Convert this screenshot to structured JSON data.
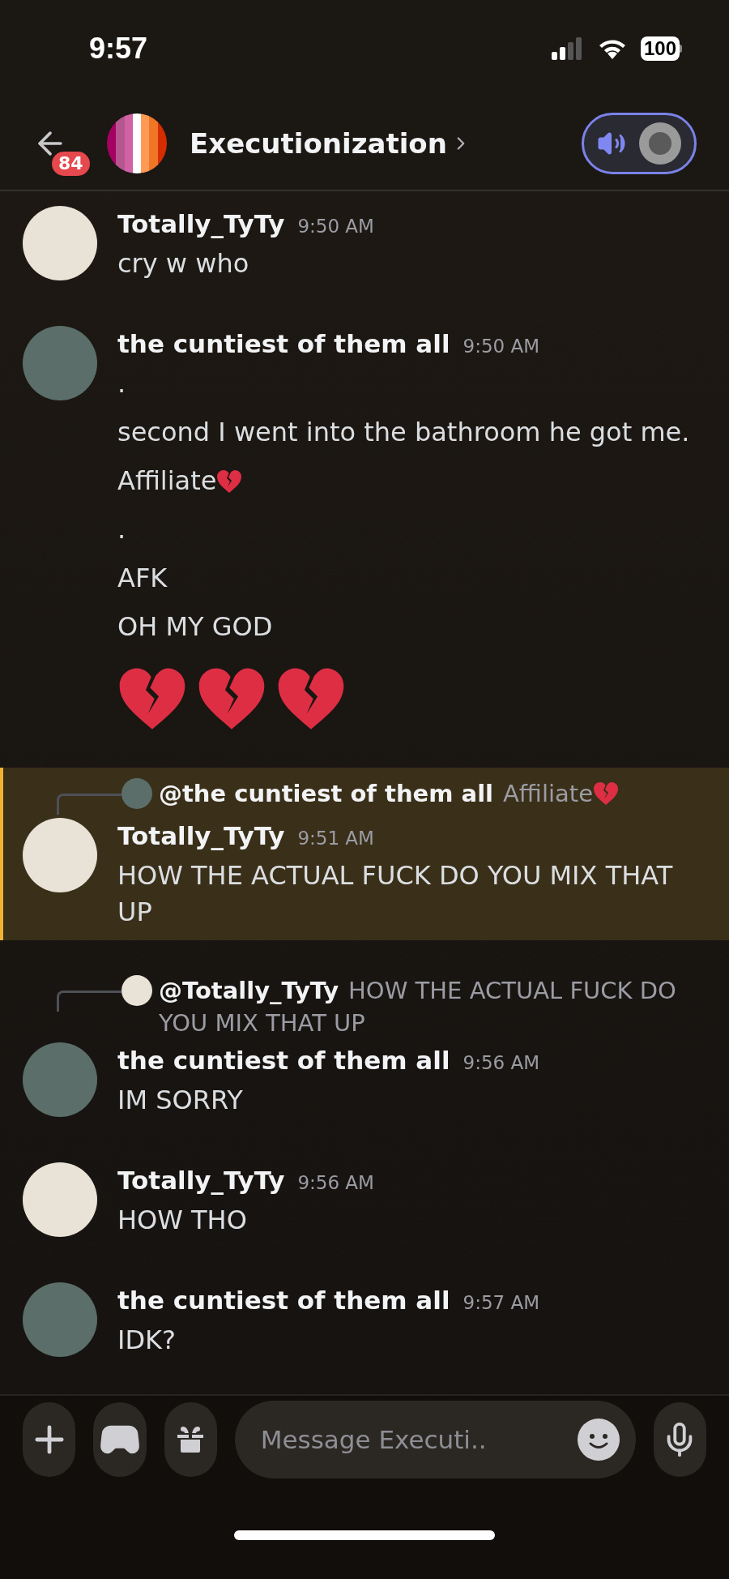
{
  "status_bar": {
    "time": "9:57",
    "battery": "100"
  },
  "header": {
    "unread_badge": "84",
    "channel_title": "Executionization"
  },
  "messages": [
    {
      "author": "Totally_TyTy",
      "time": "9:50 AM",
      "avatar": {
        "color": "#e9e2d6"
      },
      "mentioned": false,
      "lines": [
        {
          "kind": "text",
          "text": "cry w who"
        }
      ]
    },
    {
      "author": "the cuntiest of them all",
      "time": "9:50 AM",
      "avatar": {
        "color": "#5b6e6a"
      },
      "mentioned": false,
      "lines": [
        {
          "kind": "text",
          "text": "."
        },
        {
          "kind": "text",
          "text": "second I went into the bathroom he got me."
        },
        {
          "kind": "text_heart",
          "text": "Affiliate"
        },
        {
          "kind": "text",
          "text": "."
        },
        {
          "kind": "text",
          "text": "AFK"
        },
        {
          "kind": "text",
          "text": "OH MY GOD"
        },
        {
          "kind": "hearts",
          "items": [
            {
              "kind": "broken_heart"
            },
            {
              "kind": "broken_heart"
            },
            {
              "kind": "broken_heart"
            }
          ]
        }
      ]
    },
    {
      "author": "Totally_TyTy",
      "time": "9:51 AM",
      "avatar": {
        "color": "#e9e2d6"
      },
      "mentioned": true,
      "reply": {
        "author": "@the cuntiest of them all",
        "avatar": {
          "color": "#5b6e6a"
        },
        "kind": "text_heart",
        "text": "Affiliate"
      },
      "lines": [
        {
          "kind": "text",
          "text": "HOW THE ACTUAL FUCK DO YOU MIX THAT UP"
        }
      ]
    },
    {
      "author": "the cuntiest of them all",
      "time": "9:56 AM",
      "avatar": {
        "color": "#5b6e6a"
      },
      "mentioned": false,
      "reply": {
        "author": "@Totally_TyTy",
        "avatar": {
          "color": "#e9e2d6"
        },
        "kind": "text",
        "text": "HOW THE ACTUAL FUCK DO YOU MIX THAT UP"
      },
      "lines": [
        {
          "kind": "text",
          "text": "IM SORRY"
        }
      ]
    },
    {
      "author": "Totally_TyTy",
      "time": "9:56 AM",
      "avatar": {
        "color": "#e9e2d6"
      },
      "mentioned": false,
      "lines": [
        {
          "kind": "text",
          "text": "HOW THO"
        }
      ]
    },
    {
      "author": "the cuntiest of them all",
      "time": "9:57 AM",
      "avatar": {
        "color": "#5b6e6a"
      },
      "mentioned": false,
      "lines": [
        {
          "kind": "text",
          "text": "IDK?"
        }
      ]
    }
  ],
  "composer": {
    "placeholder": "Message Executi.."
  }
}
